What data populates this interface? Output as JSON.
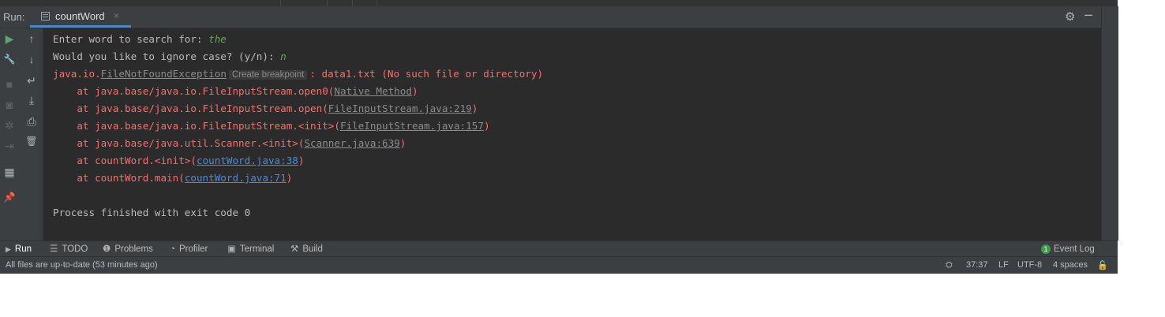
{
  "run_panel": {
    "label": "Run:",
    "tab_label": "countWord",
    "tab_close": "×",
    "settings_icon": "gear-icon",
    "hide_icon": "minus-icon"
  },
  "left_toolbar": [
    {
      "name": "rerun-icon",
      "glyph": "▶"
    },
    {
      "name": "modify-run-config-icon",
      "glyph": "🔧"
    },
    {
      "name": "stop-icon",
      "glyph": "■"
    },
    {
      "name": "camera-icon",
      "glyph": "◙"
    },
    {
      "name": "debug-icon",
      "glyph": "✲"
    },
    {
      "name": "exit-icon",
      "glyph": "⇥"
    },
    {
      "name": "layout-icon",
      "glyph": "▦"
    },
    {
      "name": "pin-icon",
      "glyph": "📌"
    }
  ],
  "second_toolbar": [
    {
      "name": "up-arrow-icon",
      "glyph": "↑"
    },
    {
      "name": "down-arrow-icon",
      "glyph": "↓"
    },
    {
      "name": "soft-wrap-icon",
      "glyph": "↵"
    },
    {
      "name": "scroll-to-end-icon",
      "glyph": "⤓"
    },
    {
      "name": "print-icon",
      "glyph": "⎙"
    },
    {
      "name": "trash-icon",
      "glyph": "🗑"
    }
  ],
  "console": {
    "prompt1": "Enter word to search for: ",
    "input1": "the",
    "prompt2": "Would you like to ignore case? (y/n): ",
    "input2": "n",
    "exception_prefix": "java.io.",
    "exception_class": "FileNotFoundException",
    "breakpoint_hint": "Create breakpoint",
    "exception_msg": ": data1.txt (No such file or directory)",
    "frames": [
      {
        "pre": "    at java.base/java.io.FileInputStream.open0(",
        "link": "Native Method",
        "link_type": "gray",
        "post": ")"
      },
      {
        "pre": "    at java.base/java.io.FileInputStream.open(",
        "link": "FileInputStream.java:219",
        "link_type": "gray",
        "post": ")"
      },
      {
        "pre": "    at java.base/java.io.FileInputStream.<init>(",
        "link": "FileInputStream.java:157",
        "link_type": "gray",
        "post": ")"
      },
      {
        "pre": "    at java.base/java.util.Scanner.<init>(",
        "link": "Scanner.java:639",
        "link_type": "gray",
        "post": ")"
      },
      {
        "pre": "    at countWord.<init>(",
        "link": "countWord.java:38",
        "link_type": "blue",
        "post": ")"
      },
      {
        "pre": "    at countWord.main(",
        "link": "countWord.java:71",
        "link_type": "blue",
        "post": ")"
      }
    ],
    "exit_msg": "Process finished with exit code 0"
  },
  "bottom_tabs": [
    {
      "label": "Run",
      "icon": "run-icon",
      "glyph": "▶",
      "active": true
    },
    {
      "label": "TODO",
      "icon": "list-icon",
      "glyph": "☰",
      "active": false
    },
    {
      "label": "Problems",
      "icon": "problems-icon",
      "glyph": "❶",
      "active": false
    },
    {
      "label": "Profiler",
      "icon": "profiler-icon",
      "glyph": "◔",
      "active": false
    },
    {
      "label": "Terminal",
      "icon": "terminal-icon",
      "glyph": "▣",
      "active": false
    },
    {
      "label": "Build",
      "icon": "hammer-icon",
      "glyph": "⚒",
      "active": false
    }
  ],
  "event_log": {
    "label": "Event Log",
    "count": "1"
  },
  "status": {
    "message": "All files are up-to-date (53 minutes ago)",
    "position": "37:37",
    "line_sep": "LF",
    "encoding": "UTF-8",
    "indent": "4 spaces"
  },
  "colors": {
    "background": "#2b2b2b",
    "panel": "#3c3f41",
    "error_text": "#ff6b68",
    "input_text": "#5ab04b",
    "link_blue": "#4a8ae0",
    "tab_underline": "#4a88c7"
  }
}
